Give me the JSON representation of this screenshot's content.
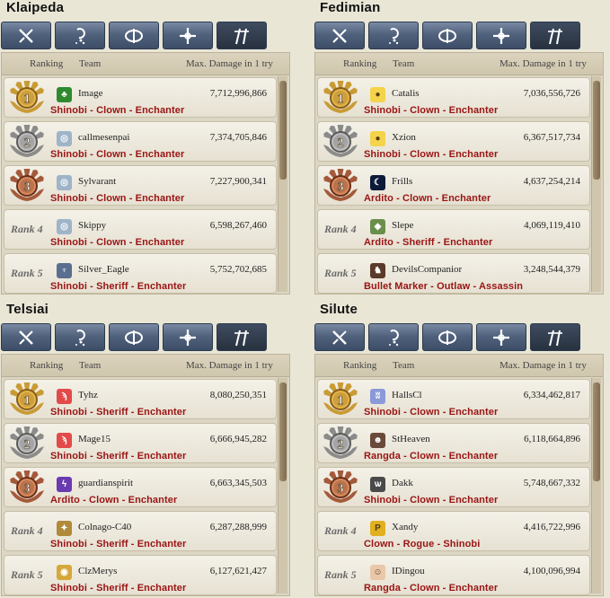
{
  "header": {
    "ranking": "Ranking",
    "team": "Team",
    "damage": "Max. Damage in 1 try"
  },
  "tab_icons": [
    "swordsman-class-icon",
    "wizard-class-icon",
    "archer-class-icon",
    "cleric-class-icon",
    "scout-class-icon"
  ],
  "colors": {
    "gold": "#c99b34",
    "silver": "#8b8b8b",
    "bronze": "#a45a3a",
    "class_text": "#9a1414",
    "tab_blue": "#51627d"
  },
  "panels": [
    {
      "server": "Klaipeda",
      "rows": [
        {
          "rank": "1",
          "team": "Image",
          "icon": "clover-team-icon",
          "damage": "7,712,996,866",
          "classes": "Shinobi - Clown - Enchanter"
        },
        {
          "rank": "2",
          "team": "callmesenpai",
          "icon": "shield-team-icon",
          "damage": "7,374,705,846",
          "classes": "Shinobi - Clown - Enchanter"
        },
        {
          "rank": "3",
          "team": "Sylvarant",
          "icon": "shield-team-icon",
          "damage": "7,227,900,341",
          "classes": "Shinobi - Clown - Enchanter"
        },
        {
          "rank": "Rank 4",
          "team": "Skippy",
          "icon": "shield-team-icon",
          "damage": "6,598,267,460",
          "classes": "Shinobi - Clown - Enchanter"
        },
        {
          "rank": "Rank 5",
          "team": "Silver_Eagle",
          "icon": "eagle-team-icon",
          "damage": "5,752,702,685",
          "classes": "Shinobi - Sheriff - Enchanter"
        }
      ]
    },
    {
      "server": "Fedimian",
      "rows": [
        {
          "rank": "1",
          "team": "Catalis",
          "icon": "chick-team-icon",
          "damage": "7,036,556,726",
          "classes": "Shinobi - Clown - Enchanter"
        },
        {
          "rank": "2",
          "team": "Xzion",
          "icon": "chick-team-icon",
          "damage": "6,367,517,734",
          "classes": "Shinobi - Clown - Enchanter"
        },
        {
          "rank": "3",
          "team": "Frills",
          "icon": "moon-team-icon",
          "damage": "4,637,254,214",
          "classes": "Ardito - Clown - Enchanter"
        },
        {
          "rank": "Rank 4",
          "team": "Slepe",
          "icon": "gem-team-icon",
          "damage": "4,069,119,410",
          "classes": "Ardito - Sheriff - Enchanter"
        },
        {
          "rank": "Rank 5",
          "team": "DevilsCompanior",
          "icon": "devil-team-icon",
          "damage": "3,248,544,379",
          "classes": "Bullet Marker - Outlaw - Assassin"
        }
      ]
    },
    {
      "server": "Telsiai",
      "rows": [
        {
          "rank": "1",
          "team": "Tyhz",
          "icon": "bird-team-icon",
          "damage": "8,080,250,351",
          "classes": "Shinobi - Sheriff - Enchanter"
        },
        {
          "rank": "2",
          "team": "Mage15",
          "icon": "bird-team-icon",
          "damage": "6,666,945,282",
          "classes": "Shinobi - Sheriff - Enchanter"
        },
        {
          "rank": "3",
          "team": "guardianspirit",
          "icon": "spirit-team-icon",
          "damage": "6,663,345,503",
          "classes": "Ardito - Clown - Enchanter"
        },
        {
          "rank": "Rank 4",
          "team": "Colnago-C40",
          "icon": "crest-team-icon",
          "damage": "6,287,288,999",
          "classes": "Shinobi - Sheriff - Enchanter"
        },
        {
          "rank": "Rank 5",
          "team": "ClzMerys",
          "icon": "coin-team-icon",
          "damage": "6,127,621,427",
          "classes": "Shinobi - Sheriff - Enchanter"
        }
      ]
    },
    {
      "server": "Silute",
      "rows": [
        {
          "rank": "1",
          "team": "HallsCl",
          "icon": "wings-team-icon",
          "damage": "6,334,462,817",
          "classes": "Shinobi - Clown - Enchanter"
        },
        {
          "rank": "2",
          "team": "StHeaven",
          "icon": "portrait-team-icon",
          "damage": "6,118,664,896",
          "classes": "Rangda - Clown - Enchanter"
        },
        {
          "rank": "3",
          "team": "Dakk",
          "icon": "bat-team-icon",
          "damage": "5,748,667,332",
          "classes": "Shinobi - Clown - Enchanter"
        },
        {
          "rank": "Rank 4",
          "team": "Xandy",
          "icon": "p-coin-team-icon",
          "damage": "4,416,722,996",
          "classes": "Clown - Rogue - Shinobi"
        },
        {
          "rank": "Rank 5",
          "team": "IDingou",
          "icon": "girl-team-icon",
          "damage": "4,100,096,994",
          "classes": "Rangda - Clown - Enchanter"
        }
      ]
    }
  ]
}
